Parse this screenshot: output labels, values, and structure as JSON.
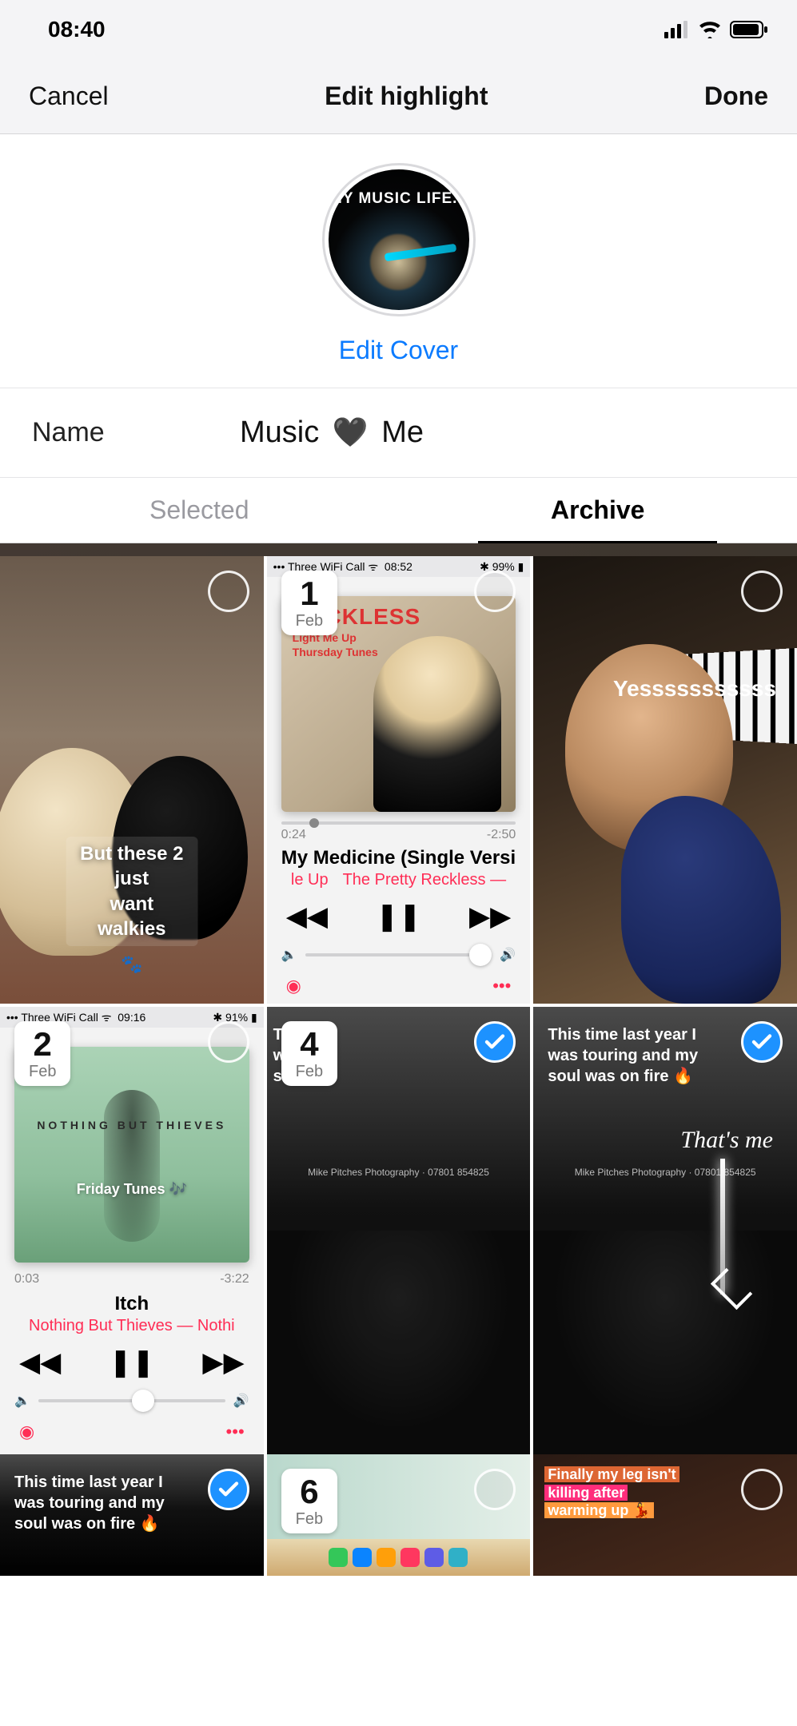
{
  "status": {
    "time": "08:40"
  },
  "nav": {
    "cancel": "Cancel",
    "title": "Edit highlight",
    "done": "Done"
  },
  "cover": {
    "banner_text": "MY MUSIC LIFE...",
    "edit_label": "Edit Cover"
  },
  "name": {
    "label": "Name",
    "value_pre": "Music",
    "value_post": "Me"
  },
  "tabs": {
    "selected": "Selected",
    "archive": "Archive"
  },
  "grid": {
    "c1": {
      "caption_l1": "But these 2 just",
      "caption_l2": "want walkies",
      "paws": "🐾"
    },
    "c2": {
      "status_left": "Three WiFi Call",
      "status_time": "08:52",
      "status_right": "99%",
      "date_day": "1",
      "date_mon": "Feb",
      "art_title": "RECKLESS",
      "art_sub1": "Light Me Up",
      "art_sub2": "Thursday Tunes",
      "t_elapsed": "0:24",
      "t_remain": "-2:50",
      "track": "My Medicine (Single Versi",
      "artist_left": "le Up",
      "artist_right": "The Pretty Reckless —"
    },
    "c3": {
      "text": "Yesssssssssss"
    },
    "c4": {
      "status_left": "Three WiFi Call",
      "status_time": "09:16",
      "status_right": "91%",
      "date_day": "2",
      "date_mon": "Feb",
      "band": "NOTHING BUT THIEVES",
      "overlay": "Friday Tunes 🎶",
      "t_elapsed": "0:03",
      "t_remain": "-3:22",
      "track": "Itch",
      "artist": "Nothing But Thieves — Nothi"
    },
    "c5": {
      "date_day": "4",
      "date_mon": "Feb",
      "text_l1": "T",
      "text_l2": "wa",
      "text_l3": "s",
      "credit": "Mike Pitches Photography · 07801 854825"
    },
    "c6": {
      "text_l1": "This time last year I",
      "text_l2": "was touring and my",
      "text_l3": "soul was on fire 🔥",
      "thatsme": "That's me",
      "credit": "Mike Pitches Photography · 07801 854825"
    },
    "c7": {
      "text_l1": "This time last year I",
      "text_l2": "was touring and my",
      "text_l3": "soul was on fire 🔥"
    },
    "c8": {
      "date_day": "6",
      "date_mon": "Feb"
    },
    "c9": {
      "l1": "Finally my leg isn't",
      "l2": "killing after",
      "l3": "warming up 💃"
    }
  }
}
